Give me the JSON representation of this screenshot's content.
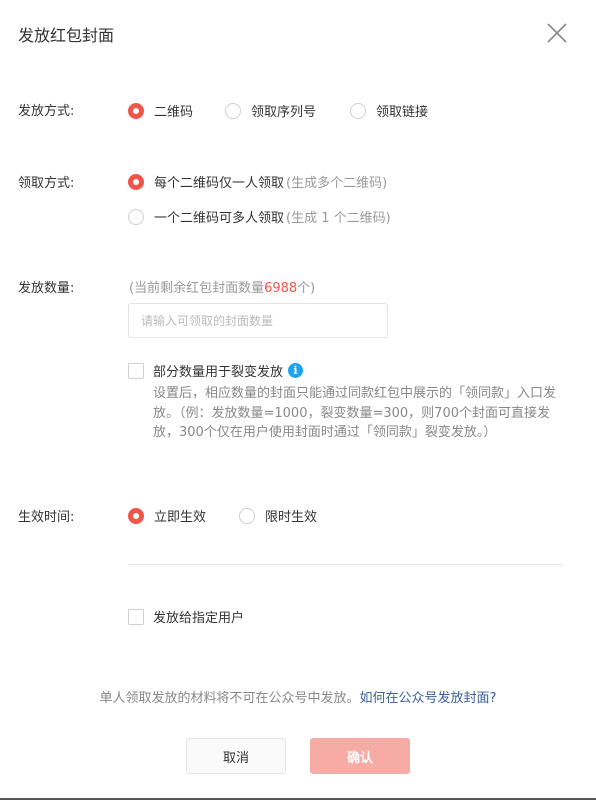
{
  "dialog": {
    "title": "发放红包封面"
  },
  "issue_method": {
    "label": "发放方式:",
    "options": [
      "二维码",
      "领取序列号",
      "领取链接"
    ],
    "selected": 0
  },
  "receive_method": {
    "label": "领取方式:",
    "options": [
      {
        "text": "每个二维码仅一人领取",
        "hint": "(生成多个二维码)"
      },
      {
        "text": "一个二维码可多人领取",
        "hint": "(生成 1 个二维码)"
      }
    ],
    "selected": 0
  },
  "quantity": {
    "label": "发放数量:",
    "remain_prefix": "(当前剩余红包封面数量",
    "remain_count": "6988",
    "remain_suffix": "个)",
    "placeholder": "请输入可领取的封面数量",
    "value": ""
  },
  "fission": {
    "label": "部分数量用于裂变发放",
    "checked": false,
    "info_icon": "i",
    "description": "设置后，相应数量的封面只能通过同款红包中展示的「领同款」入口发放。（例：发放数量=1000，裂变数量=300，则700个封面可直接发放，300个仅在用户使用封面时通过「领同款」裂变发放。）"
  },
  "effective_time": {
    "label": "生效时间:",
    "options": [
      "立即生效",
      "限时生效"
    ],
    "selected": 0
  },
  "target_users": {
    "label": "发放给指定用户",
    "checked": false
  },
  "footer": {
    "note": "单人领取发放的材料将不可在公众号中发放。",
    "link": "如何在公众号发放封面?"
  },
  "buttons": {
    "cancel": "取消",
    "confirm": "确认"
  },
  "colors": {
    "accent": "#f0554a",
    "confirm_disabled": "#f7aba5",
    "link": "#3a5f9a",
    "info": "#1aa3f0"
  }
}
